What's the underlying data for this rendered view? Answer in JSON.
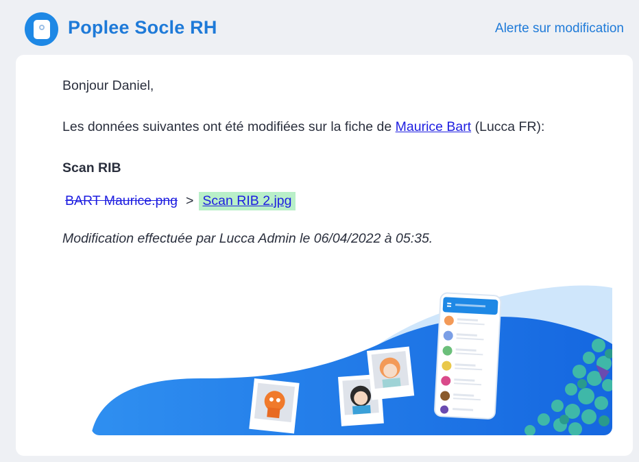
{
  "header": {
    "app_title": "Poplee Socle RH",
    "alert_label": "Alerte sur modification"
  },
  "email": {
    "greeting": "Bonjour Daniel,",
    "intro_prefix": "Les données suivantes ont été modifiées sur la fiche de ",
    "employee_name": "Maurice Bart",
    "intro_suffix": " (Lucca FR):",
    "section_title": "Scan RIB",
    "old_file": "BART Maurice.png",
    "arrow": ">",
    "new_file": "Scan RIB 2.jpg",
    "footer_note": "Modification effectuée par Lucca Admin le 06/04/2022 à 05:35."
  },
  "colors": {
    "brand_blue": "#1e7ad8",
    "link_blue": "#1d1de0",
    "added_highlight": "#b9efc8",
    "background": "#eef0f4"
  },
  "icons": {
    "app_logo": "document-icon"
  }
}
